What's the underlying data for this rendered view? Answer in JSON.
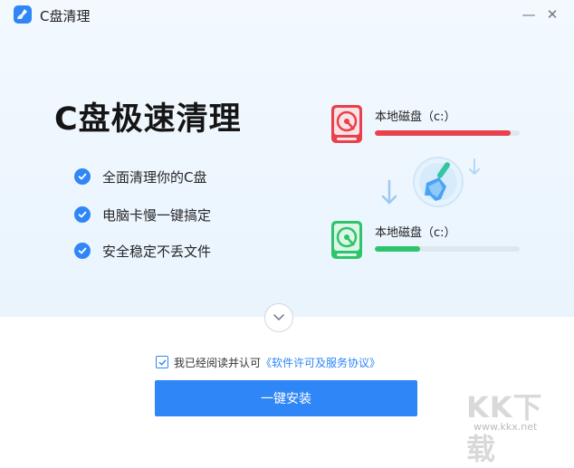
{
  "window": {
    "title": "C盘清理",
    "minimize_symbol": "—",
    "close_symbol": "✕"
  },
  "hero": {
    "headline": "C盘极速清理",
    "features": [
      {
        "text": "全面清理你的C盘",
        "icon": "check-circle-icon"
      },
      {
        "text": "电脑卡慢一键搞定",
        "icon": "check-circle-icon"
      },
      {
        "text": "安全稳定不丢文件",
        "icon": "check-circle-icon"
      }
    ]
  },
  "disks": [
    {
      "label": "本地磁盘（c:）",
      "usage": 0.94,
      "state": "before",
      "color": "#e8404c"
    },
    {
      "label": "本地磁盘（c:）",
      "usage": 0.31,
      "state": "after",
      "color": "#2ec46c"
    }
  ],
  "footer": {
    "agree_checked": true,
    "agree_text": "我已经阅读并认可",
    "agree_link": "《软件许可及服务协议》",
    "install_label": "一键安装"
  },
  "watermark": {
    "letters": "KK下载",
    "url": "www.kkx.net"
  },
  "colors": {
    "accent": "#2f86f6",
    "danger": "#e8404c",
    "success": "#2ec46c"
  }
}
